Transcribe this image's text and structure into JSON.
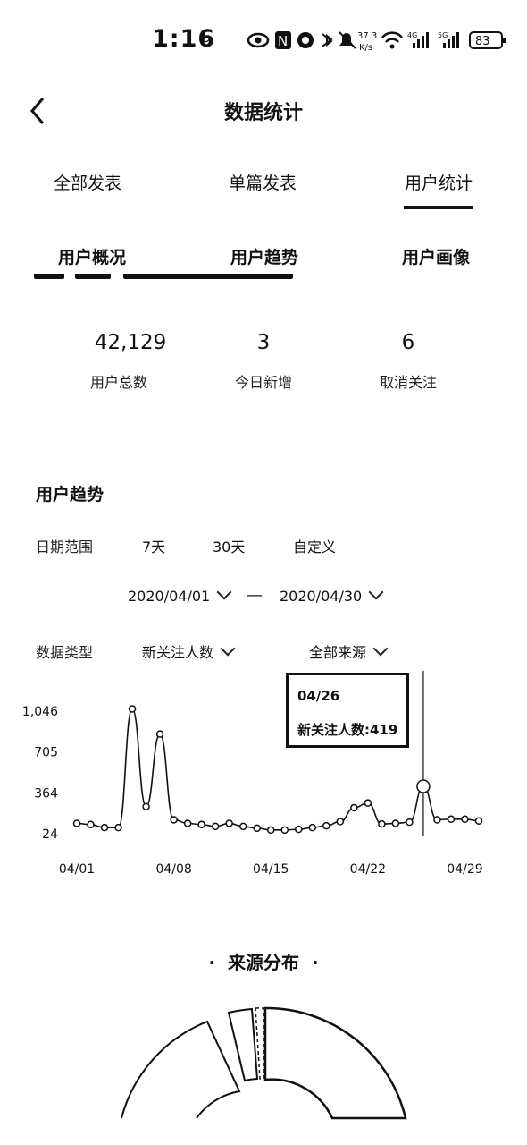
{
  "status": {
    "time": "1:16",
    "net_speed": "37.3",
    "net_unit": "K/s",
    "battery": "83"
  },
  "header": {
    "title": "数据统计"
  },
  "tabs": [
    {
      "label": "全部发表"
    },
    {
      "label": "单篇发表"
    },
    {
      "label": "用户统计"
    }
  ],
  "sub_tabs": [
    {
      "label": "用户概况"
    },
    {
      "label": "用户趋势"
    },
    {
      "label": "用户画像"
    }
  ],
  "stats": [
    {
      "value": "42,129",
      "label": "用户总数"
    },
    {
      "value": "3",
      "label": "今日新增"
    },
    {
      "value": "6",
      "label": "取消关注"
    }
  ],
  "trend": {
    "title": "用户趋势",
    "date_range_label": "日期范围",
    "range_options": [
      "7天",
      "30天",
      "自定义"
    ],
    "start_date": "2020/04/01",
    "end_date": "2020/04/30",
    "separator": "—",
    "data_type_label": "数据类型",
    "data_type_value": "新关注人数",
    "source_value": "全部来源",
    "tooltip": {
      "date": "04/26",
      "text": "新关注人数:419"
    }
  },
  "chart_data": {
    "type": "line",
    "yticks": [
      "24",
      "364",
      "705",
      "1,046"
    ],
    "xticks": [
      "04/01",
      "04/08",
      "04/15",
      "04/22",
      "04/29"
    ],
    "ylim": [
      24,
      1046
    ],
    "x": [
      1,
      2,
      3,
      4,
      5,
      6,
      7,
      8,
      9,
      10,
      11,
      12,
      13,
      14,
      15,
      16,
      17,
      18,
      19,
      20,
      21,
      22,
      23,
      24,
      25,
      26,
      27,
      28,
      29,
      30
    ],
    "values": [
      110,
      100,
      75,
      75,
      1065,
      250,
      855,
      140,
      110,
      100,
      85,
      110,
      85,
      70,
      55,
      55,
      60,
      75,
      90,
      125,
      240,
      280,
      105,
      110,
      120,
      419,
      140,
      145,
      145,
      130
    ],
    "highlight_index": 25,
    "grid": false
  },
  "source": {
    "title": "来源分布"
  }
}
